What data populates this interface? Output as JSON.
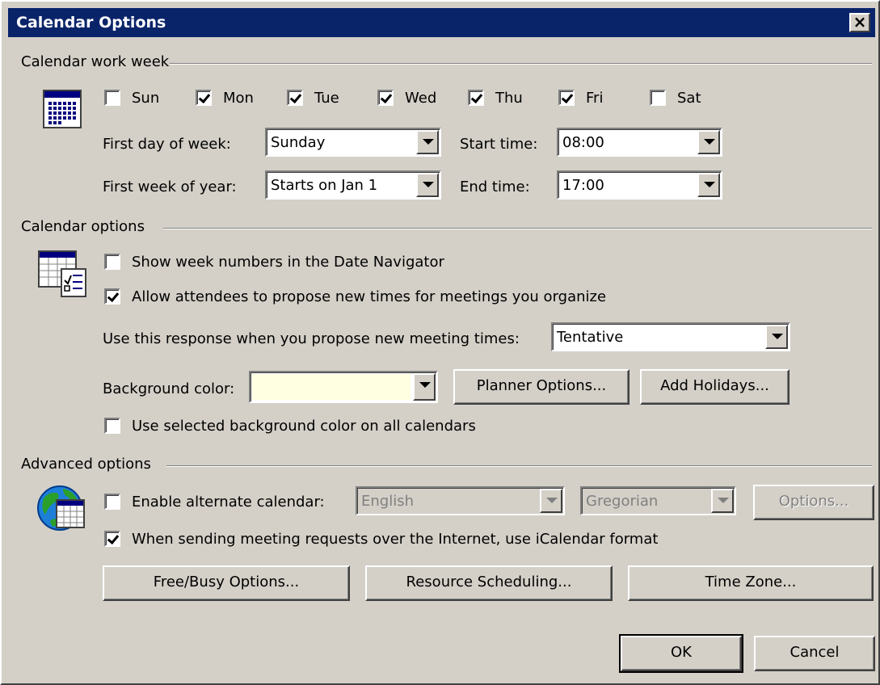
{
  "window": {
    "title": "Calendar Options",
    "close_label": "×"
  },
  "work_week": {
    "section_label": "Calendar work week",
    "days": [
      {
        "label": "Sun",
        "checked": false
      },
      {
        "label": "Mon",
        "checked": true
      },
      {
        "label": "Tue",
        "checked": true
      },
      {
        "label": "Wed",
        "checked": true
      },
      {
        "label": "Thu",
        "checked": true
      },
      {
        "label": "Fri",
        "checked": true
      },
      {
        "label": "Sat",
        "checked": false
      }
    ],
    "first_day_label": "First day of week:",
    "first_day_value": "Sunday",
    "first_week_label": "First week of year:",
    "first_week_value": "Starts on Jan 1",
    "start_time_label": "Start time:",
    "start_time_value": "08:00",
    "end_time_label": "End time:",
    "end_time_value": "17:00"
  },
  "calendar_options": {
    "section_label": "Calendar options",
    "show_week_numbers": {
      "label": "Show week numbers in the Date Navigator",
      "checked": false
    },
    "allow_propose": {
      "label": "Allow attendees to propose new times for meetings you organize",
      "checked": true
    },
    "response_label": "Use this response when you propose new meeting times:",
    "response_value": "Tentative",
    "background_color_label": "Background color:",
    "background_color": "#ffffe1",
    "planner_options_label": "Planner Options...",
    "add_holidays_label": "Add Holidays...",
    "use_selected_bg": {
      "label": "Use selected background color on all calendars",
      "checked": false
    }
  },
  "advanced": {
    "section_label": "Advanced options",
    "enable_alternate": {
      "label": "Enable alternate calendar:",
      "checked": false
    },
    "language_value": "English",
    "calendar_type_value": "Gregorian",
    "options_label": "Options...",
    "icalendar": {
      "label": "When sending meeting requests over the Internet, use iCalendar format",
      "checked": true
    },
    "free_busy_label": "Free/Busy Options...",
    "resource_scheduling_label": "Resource Scheduling...",
    "time_zone_label": "Time Zone..."
  },
  "footer": {
    "ok_label": "OK",
    "cancel_label": "Cancel"
  },
  "colors": {
    "title_bar": "#0a246a",
    "dialog_face": "#d4d0c8"
  },
  "icons": [
    "calendar-grid-icon",
    "calendar-options-icon",
    "globe-calendar-icon"
  ]
}
